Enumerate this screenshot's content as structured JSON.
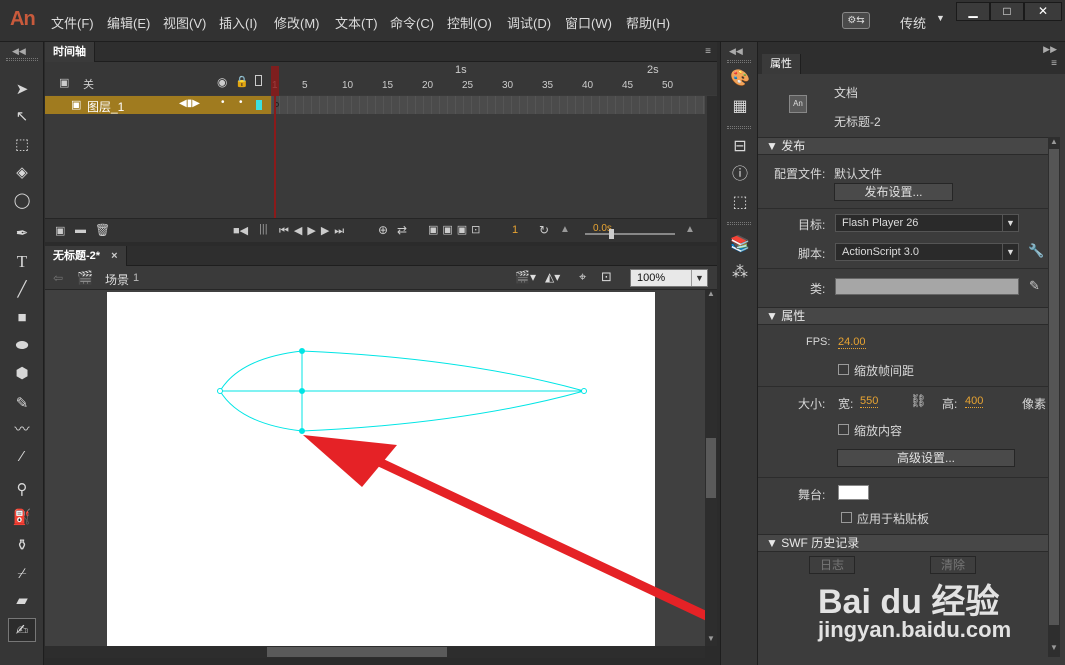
{
  "app": {
    "logo": "An"
  },
  "menu": [
    "文件(F)",
    "编辑(E)",
    "视图(V)",
    "插入(I)",
    "修改(M)",
    "文本(T)",
    "命令(C)",
    "控制(O)",
    "调试(D)",
    "窗口(W)",
    "帮助(H)"
  ],
  "workspace": "传统",
  "timeline": {
    "tab": "时间轴",
    "header_label": "关",
    "ruler_seconds": [
      "1s",
      "2s"
    ],
    "ruler_frames": [
      "1",
      "5",
      "10",
      "15",
      "20",
      "25",
      "30",
      "35",
      "40",
      "45",
      "50"
    ],
    "layer_name": "图层_1",
    "footer_frame": "1",
    "footer_time": "0.0s"
  },
  "stage": {
    "doc_tab": "无标题-2*",
    "scene_label": "场景",
    "scene_number": "1",
    "zoom": "100%"
  },
  "properties": {
    "tab": "属性",
    "doc_icon": "An",
    "doc_type": "文档",
    "doc_name": "无标题-2",
    "publish_header": "发布",
    "profile_label": "配置文件:",
    "profile_value": "默认文件",
    "publish_settings_btn": "发布设置...",
    "target_label": "目标:",
    "target_value": "Flash Player 26",
    "script_label": "脚本:",
    "script_value": "ActionScript 3.0",
    "class_label": "类:",
    "props_header": "属性",
    "fps_label": "FPS:",
    "fps_value": "24.00",
    "scale_spacing": "缩放帧间距",
    "size_label": "大小:",
    "width_label": "宽:",
    "width_value": "550",
    "height_label": "高:",
    "height_value": "400",
    "unit": "像素",
    "scale_content": "缩放内容",
    "advanced_btn": "高级设置...",
    "stage_label": "舞台:",
    "stage_color": "#ffffff",
    "apply_clipboard": "应用于粘贴板",
    "swf_header": "SWF 历史记录",
    "log_btn": "日志",
    "clear_btn": "清除"
  },
  "watermark": {
    "brand": "Bai du 经验",
    "url": "jingyan.baidu.com"
  },
  "colors": {
    "layer_bar": "#a07b1f",
    "shape_stroke": "#00e5e5",
    "arrow": "#e52226",
    "playhead": "#8b1a1a",
    "accent_value": "#e7a332"
  }
}
